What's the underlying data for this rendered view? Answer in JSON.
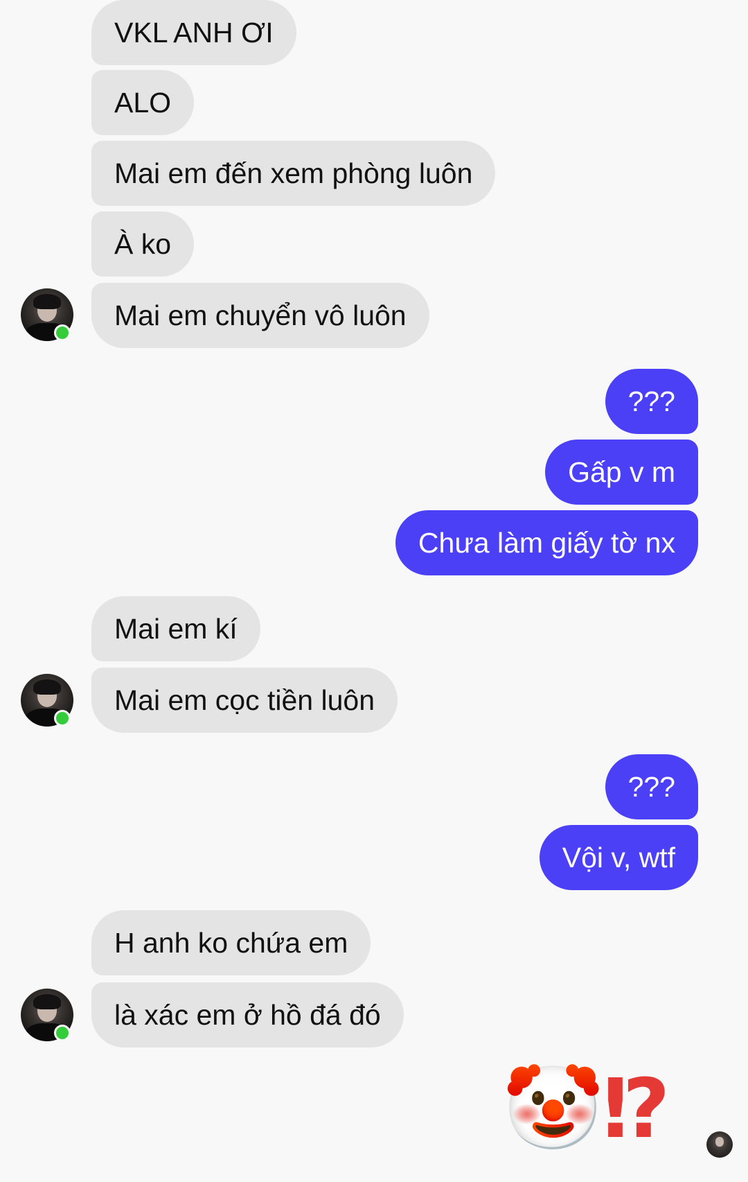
{
  "conversation": {
    "messages": [
      {
        "side": "in",
        "text": "VKL ANH ƠI"
      },
      {
        "side": "in",
        "text": "ALO"
      },
      {
        "side": "in",
        "text": "Mai em đến xem phòng luôn"
      },
      {
        "side": "in",
        "text": "À ko"
      },
      {
        "side": "in",
        "text": "Mai em chuyển vô luôn"
      },
      {
        "side": "out",
        "text": "???"
      },
      {
        "side": "out",
        "text": "Gấp v m"
      },
      {
        "side": "out",
        "text": "Chưa làm giấy tờ nx"
      },
      {
        "side": "in",
        "text": "Mai em kí"
      },
      {
        "side": "in",
        "text": "Mai em cọc tiền luôn"
      },
      {
        "side": "out",
        "text": "???"
      },
      {
        "side": "out",
        "text": "Vội v, wtf"
      },
      {
        "side": "in",
        "text": "H anh ko chứa em"
      },
      {
        "side": "in",
        "text": "là xác em ở hồ đá đó"
      }
    ],
    "reactions": [
      "🤡",
      "⁉"
    ],
    "colors": {
      "incoming_bubble": "#e4e4e4",
      "outgoing_bubble": "#4b40f5",
      "online_dot": "#35cc3b",
      "background": "#f8f8f8"
    }
  }
}
